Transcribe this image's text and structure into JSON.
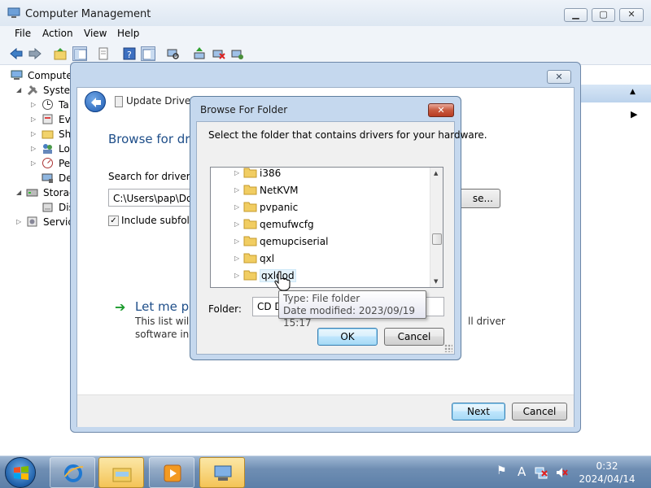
{
  "main_window": {
    "title": "Computer Management",
    "menu": [
      "File",
      "Action",
      "View",
      "Help"
    ],
    "tree_items": [
      {
        "label": "Computer",
        "icon": "computer-icon"
      },
      {
        "label": "System",
        "icon": "tools-icon"
      },
      {
        "label": "Ta",
        "icon": "clock-icon"
      },
      {
        "label": "Eve",
        "icon": "event-viewer-icon"
      },
      {
        "label": "Sh",
        "icon": "shared-folder-icon"
      },
      {
        "label": "Lo",
        "icon": "users-icon"
      },
      {
        "label": "Pe",
        "icon": "performance-icon"
      },
      {
        "label": "De",
        "icon": "device-manager-icon"
      },
      {
        "label": "Storag",
        "icon": "storage-icon"
      },
      {
        "label": "Dis",
        "icon": "disk-icon"
      },
      {
        "label": "Service",
        "icon": "services-icon"
      }
    ]
  },
  "update_driver": {
    "title": "Update Driver Software - Red Hat VirtIO...",
    "heading": "Browse for driv",
    "search_label": "Search for driver so",
    "path_value": "C:\\Users\\pap\\Doc",
    "browse_label": "se...",
    "include_subfolders": "Include subfolde",
    "include_checked": true,
    "let_me_pick": "Let me pic",
    "list_text_1": "This list will s",
    "list_text_2": "software in th",
    "list_text_tail": "ll driver",
    "next_label": "Next",
    "cancel_label": "Cancel"
  },
  "browse_folder": {
    "title": "Browse For Folder",
    "prompt": "Select the folder that contains drivers for your hardware.",
    "folders": [
      "i386",
      "NetKVM",
      "pvpanic",
      "qemufwcfg",
      "qemupciserial",
      "qxl",
      "qxldod"
    ],
    "folder_label": "Folder:",
    "folder_value": "CD Dri",
    "ok_label": "OK",
    "cancel_label": "Cancel",
    "tooltip_type": "Type: File folder",
    "tooltip_modified": "Date modified: 2023/09/19 15:17"
  },
  "taskbar": {
    "time": "0:32",
    "date": "2024/04/14",
    "ime": "A"
  },
  "colors": {
    "accent_heading": "#1e4e89",
    "dialog_frame": "#c5d8ee",
    "default_button": "#bee6fd"
  }
}
